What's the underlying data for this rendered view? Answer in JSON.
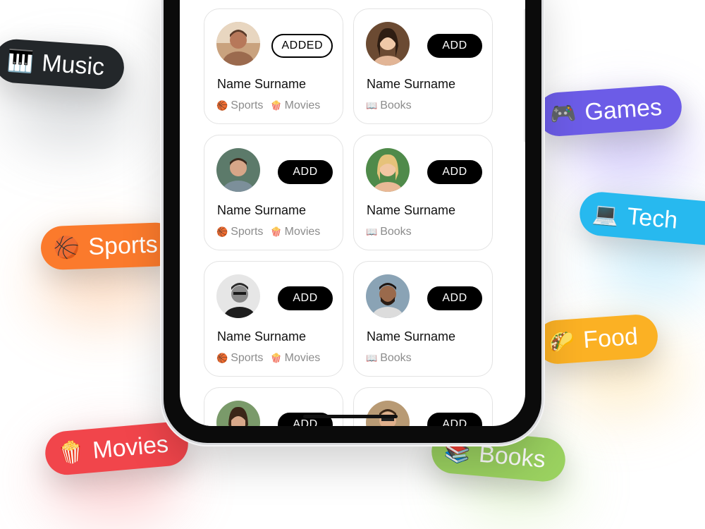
{
  "tags": {
    "music": {
      "emoji": "🎹",
      "label": "Music",
      "color": "#23272a"
    },
    "games": {
      "emoji": "🎮",
      "label": "Games",
      "color": "#6c5ce7"
    },
    "sports": {
      "emoji": "🏀",
      "label": "Sports",
      "color": "#fb7a2c"
    },
    "tech": {
      "emoji": "💻",
      "label": "Tech",
      "color": "#27b9ef"
    },
    "food": {
      "emoji": "🌮",
      "label": "Food",
      "color": "#fbb124"
    },
    "movies": {
      "emoji": "🍿",
      "label": "Movies",
      "color": "#f1454b"
    },
    "books": {
      "emoji": "📚",
      "label": "Books",
      "color": "#9bd260"
    }
  },
  "cards": [
    {
      "name": "Name Surname",
      "button": "ADDED",
      "added": true,
      "interests": [
        {
          "icon": "🏀",
          "label": "Sports"
        },
        {
          "icon": "🍿",
          "label": "Movies"
        }
      ]
    },
    {
      "name": "Name Surname",
      "button": "ADD",
      "added": false,
      "interests": [
        {
          "icon": "📖",
          "label": "Books"
        }
      ]
    },
    {
      "name": "Name Surname",
      "button": "ADD",
      "added": false,
      "interests": [
        {
          "icon": "🏀",
          "label": "Sports"
        },
        {
          "icon": "🍿",
          "label": "Movies"
        }
      ]
    },
    {
      "name": "Name Surname",
      "button": "ADD",
      "added": false,
      "interests": [
        {
          "icon": "📖",
          "label": "Books"
        }
      ]
    },
    {
      "name": "Name Surname",
      "button": "ADD",
      "added": false,
      "interests": [
        {
          "icon": "🏀",
          "label": "Sports"
        },
        {
          "icon": "🍿",
          "label": "Movies"
        }
      ]
    },
    {
      "name": "Name Surname",
      "button": "ADD",
      "added": false,
      "interests": [
        {
          "icon": "📖",
          "label": "Books"
        }
      ]
    },
    {
      "name": "",
      "button": "ADD",
      "added": false,
      "interests": []
    },
    {
      "name": "",
      "button": "ADD",
      "added": false,
      "interests": []
    }
  ]
}
